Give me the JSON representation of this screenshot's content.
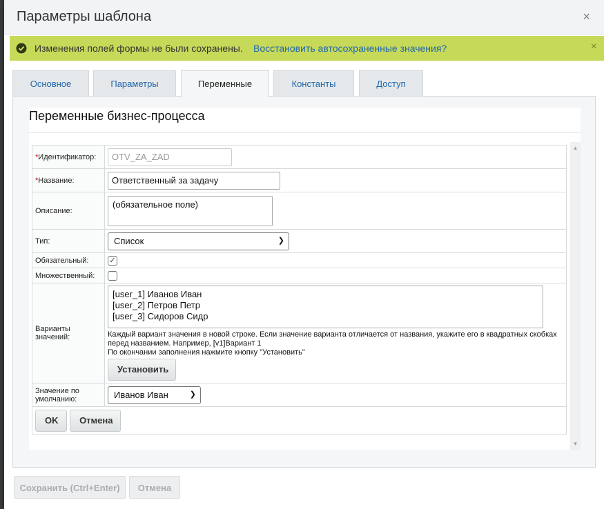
{
  "dialog": {
    "title": "Параметры шаблона",
    "close_glyph": "×"
  },
  "notice": {
    "message": "Изменения полей формы не были сохранены.",
    "link": "Восстановить автосохраненные значения?",
    "close_glyph": "×"
  },
  "tabs": [
    {
      "label": "Основное"
    },
    {
      "label": "Параметры"
    },
    {
      "label": "Переменные"
    },
    {
      "label": "Константы"
    },
    {
      "label": "Доступ"
    }
  ],
  "panel": {
    "title": "Переменные бизнес-процесса"
  },
  "form": {
    "required_mark": "*",
    "identifier": {
      "label": "Идентификатор:",
      "value": "OTV_ZA_ZAD"
    },
    "name": {
      "label": "Название:",
      "value": "Ответственный за задачу"
    },
    "description": {
      "label": "Описание:",
      "value": "(обязательное поле)"
    },
    "type": {
      "label": "Тип:",
      "value": "Список"
    },
    "required": {
      "label": "Обязательный:",
      "checked": true,
      "check_glyph": "✓"
    },
    "multiple": {
      "label": "Множественный:",
      "checked": false
    },
    "variants": {
      "label": "Варианты значений:",
      "value": "[user_1] Иванов Иван\n[user_2] Петров Петр\n[user_3] Сидоров Сидр",
      "hint": "Каждый вариант значения в новой строке. Если значение варианта отличается от названия, укажите его в квадратных скобках перед названием. Например, [v1]Вариант 1",
      "hint2": "По окончании заполнения нажмите кнопку \"Установить\"",
      "set_button": "Установить"
    },
    "default": {
      "label": "Значение по умолчанию:",
      "value": "Иванов Иван"
    },
    "ok_button": "OK",
    "cancel_button": "Отмена"
  },
  "footer": {
    "save_button": "Сохранить (Ctrl+Enter)",
    "cancel_button": "Отмена"
  },
  "colors": {
    "notice_bg": "#c7d959",
    "link": "#2067b0",
    "required": "#dd0000"
  }
}
